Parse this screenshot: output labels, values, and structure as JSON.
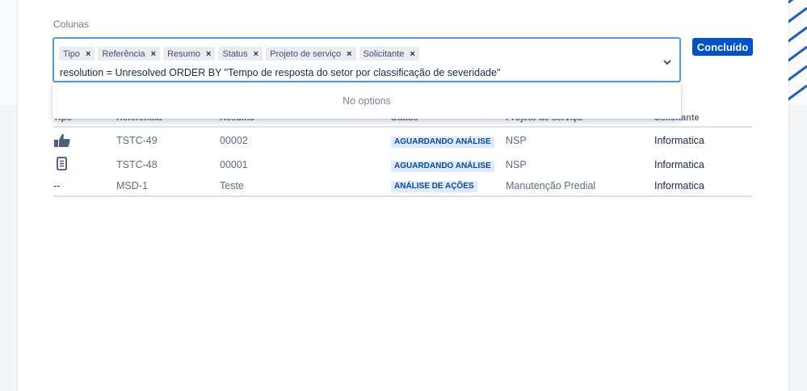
{
  "section_label": "Colunas",
  "picker": {
    "chips": [
      {
        "label": "Tipo",
        "remove": "×"
      },
      {
        "label": "Referência",
        "remove": "×"
      },
      {
        "label": "Resumo",
        "remove": "×"
      },
      {
        "label": "Status",
        "remove": "×"
      },
      {
        "label": "Projeto de serviço",
        "remove": "×"
      },
      {
        "label": "Solicitante",
        "remove": "×"
      }
    ],
    "query_value": "resolution = Unresolved ORDER BY \"Tempo de resposta do setor por classificação de severidade\"",
    "dropdown_message": "No options"
  },
  "done_button": "Concluído",
  "table": {
    "headers": [
      "Tipo",
      "Referência",
      "Resumo",
      "Status",
      "Projeto de serviço",
      "Solicitante"
    ],
    "rows": [
      {
        "type_icon": "thumbs-up-icon",
        "type_text": "",
        "ref": "TSTC-49",
        "summary": "00002",
        "status": "AGUARDANDO ANÁLISE",
        "project": "NSP",
        "requester": "Informatica"
      },
      {
        "type_icon": "document-icon",
        "type_text": "",
        "ref": "TSTC-48",
        "summary": "00001",
        "status": "AGUARDANDO ANÁLISE",
        "project": "NSP",
        "requester": "Informatica"
      },
      {
        "type_icon": "",
        "type_text": "--",
        "ref": "MSD-1",
        "summary": "Teste",
        "status": "ANÁLISE DE AÇÕES",
        "project": "Manutenção Predial",
        "requester": "Informatica"
      }
    ]
  },
  "colors": {
    "primary": "#0052cc",
    "focus": "#4c9aff",
    "lozenge_bg": "#deebff",
    "lozenge_text": "#0747a6"
  }
}
